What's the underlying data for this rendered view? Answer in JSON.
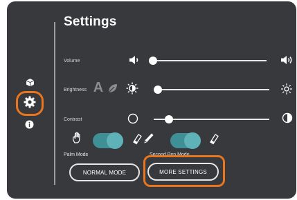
{
  "settings": {
    "title": "Settings",
    "volume": {
      "label": "Volume",
      "level": 0.02
    },
    "brightness": {
      "label": "Brightness",
      "level": 0.05
    },
    "contrast": {
      "label": "Contrast",
      "level": 0.12
    },
    "palm_mode": {
      "label": "Palm Mode",
      "enabled": true
    },
    "second_pen_mode": {
      "label": "Second Pen Mode",
      "enabled": true
    },
    "buttons": {
      "normal_mode": "NORMAL MODE",
      "more_settings": "MORE SETTINGS"
    }
  },
  "colors": {
    "panel": "#37393c",
    "highlight": "#e9751e",
    "toggle_on": "#5fb3b8"
  },
  "icons": [
    "cube-icon",
    "gear-icon",
    "info-icon",
    "speaker-low-icon",
    "speaker-high-icon",
    "auto-brightness-icon",
    "leaf-icon",
    "sun-low-icon",
    "sun-high-icon",
    "circle-empty-icon",
    "half-circle-icon",
    "palm-icon",
    "eraser-icon",
    "pen-icon"
  ]
}
